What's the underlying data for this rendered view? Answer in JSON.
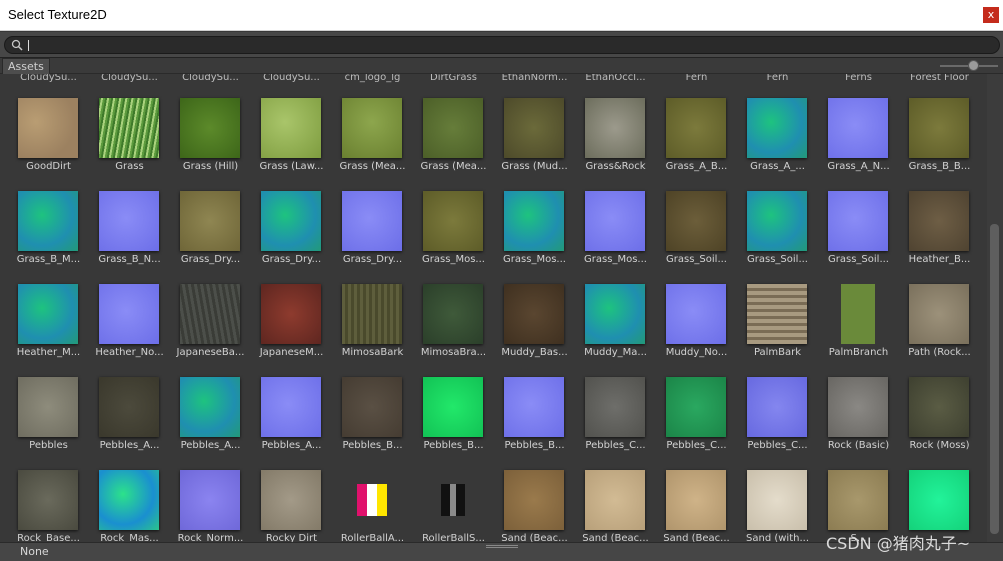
{
  "window": {
    "title": "Select Texture2D",
    "close_label": "x"
  },
  "search": {
    "value": ""
  },
  "tabs": {
    "assets": "Assets"
  },
  "grid": {
    "top_row": [
      "CloudySu...",
      "CloudySu...",
      "CloudySu...",
      "CloudySu...",
      "cm_logo_lg",
      "DirtGrass",
      "EthanNorm...",
      "EthanOccl...",
      "Fern",
      "Fern",
      "Ferns",
      "Forest Floor"
    ],
    "rows": [
      [
        {
          "label": "GoodDirt",
          "tex": "dirt"
        },
        {
          "label": "Grass",
          "tex": "grassblades"
        },
        {
          "label": "Grass (Hill)",
          "tex": "grass_hill"
        },
        {
          "label": "Grass (Law...",
          "tex": "grass_lawn"
        },
        {
          "label": "Grass (Mea...",
          "tex": "grass_mea1"
        },
        {
          "label": "Grass (Mea...",
          "tex": "grass_mea2"
        },
        {
          "label": "Grass (Mud...",
          "tex": "grass_mud"
        },
        {
          "label": "Grass&Rock",
          "tex": "grass_rock"
        },
        {
          "label": "Grass_A_B...",
          "tex": "olive"
        },
        {
          "label": "Grass_A_...",
          "tex": "normal_green"
        },
        {
          "label": "Grass_A_N...",
          "tex": "normal_blue"
        },
        {
          "label": "Grass_B_B...",
          "tex": "olive"
        }
      ],
      [
        {
          "label": "Grass_B_M...",
          "tex": "normal_green"
        },
        {
          "label": "Grass_B_N...",
          "tex": "normal_blue"
        },
        {
          "label": "Grass_Dry...",
          "tex": "olive_dry"
        },
        {
          "label": "Grass_Dry...",
          "tex": "normal_green"
        },
        {
          "label": "Grass_Dry...",
          "tex": "normal_blue"
        },
        {
          "label": "Grass_Mos...",
          "tex": "olive"
        },
        {
          "label": "Grass_Mos...",
          "tex": "normal_green"
        },
        {
          "label": "Grass_Mos...",
          "tex": "normal_blue"
        },
        {
          "label": "Grass_Soil...",
          "tex": "soil"
        },
        {
          "label": "Grass_Soil...",
          "tex": "normal_green"
        },
        {
          "label": "Grass_Soil...",
          "tex": "normal_blue"
        },
        {
          "label": "Heather_B...",
          "tex": "heather"
        }
      ],
      [
        {
          "label": "Heather_M...",
          "tex": "normal_green"
        },
        {
          "label": "Heather_No...",
          "tex": "normal_blue"
        },
        {
          "label": "JapaneseBa...",
          "tex": "bark_gray"
        },
        {
          "label": "JapaneseM...",
          "tex": "maple"
        },
        {
          "label": "MimosaBark",
          "tex": "mimosa"
        },
        {
          "label": "MimosaBra...",
          "tex": "mimosa_branch"
        },
        {
          "label": "Muddy_Bas...",
          "tex": "muddy"
        },
        {
          "label": "Muddy_Ma...",
          "tex": "normal_green"
        },
        {
          "label": "Muddy_No...",
          "tex": "normal_blue"
        },
        {
          "label": "PalmBark",
          "tex": "palmbark"
        },
        {
          "label": "PalmBranch",
          "tex": "palmbranch"
        },
        {
          "label": "Path (Rock...",
          "tex": "path_rock"
        }
      ],
      [
        {
          "label": "Pebbles",
          "tex": "pebbles"
        },
        {
          "label": "Pebbles_A...",
          "tex": "pebbles_dark"
        },
        {
          "label": "Pebbles_A...",
          "tex": "normal_green"
        },
        {
          "label": "Pebbles_A...",
          "tex": "normal_blue"
        },
        {
          "label": "Pebbles_B...",
          "tex": "pebbles_brown"
        },
        {
          "label": "Pebbles_B...",
          "tex": "bright_green"
        },
        {
          "label": "Pebbles_B...",
          "tex": "normal_blue"
        },
        {
          "label": "Pebbles_C...",
          "tex": "rock_gray"
        },
        {
          "label": "Pebbles_C...",
          "tex": "green_speckle"
        },
        {
          "label": "Pebbles_C...",
          "tex": "normal_blue_bumpy"
        },
        {
          "label": "Rock (Basic)",
          "tex": "rock_basic"
        },
        {
          "label": "Rock (Moss)",
          "tex": "rock_moss"
        }
      ],
      [
        {
          "label": "Rock_Base...",
          "tex": "rock_base"
        },
        {
          "label": "Rock_Mas...",
          "tex": "rock_mask"
        },
        {
          "label": "Rock_Norm...",
          "tex": "rock_normal"
        },
        {
          "label": "Rocky Dirt",
          "tex": "rocky_dirt"
        },
        {
          "label": "RollerBallA...",
          "tex": "rollerball_a"
        },
        {
          "label": "RollerBallS...",
          "tex": "rollerball_s"
        },
        {
          "label": "Sand (Beac...",
          "tex": "sand_dark"
        },
        {
          "label": "Sand (Beac...",
          "tex": "sand_light"
        },
        {
          "label": "Sand (Beac...",
          "tex": "sand_mid"
        },
        {
          "label": "Sand (with...",
          "tex": "sand_white"
        },
        {
          "label": "S...",
          "tex": "sand_plain"
        },
        {
          "label": "",
          "tex": "bright_green_flat"
        }
      ]
    ]
  },
  "status": {
    "text": "None"
  },
  "watermark": "CSDN @猪肉丸子~",
  "colors": {
    "window_bg": "#383838",
    "close_red": "#c42b1c",
    "normal_blue": "#7a7af0",
    "normal_green": "#23b07e"
  }
}
